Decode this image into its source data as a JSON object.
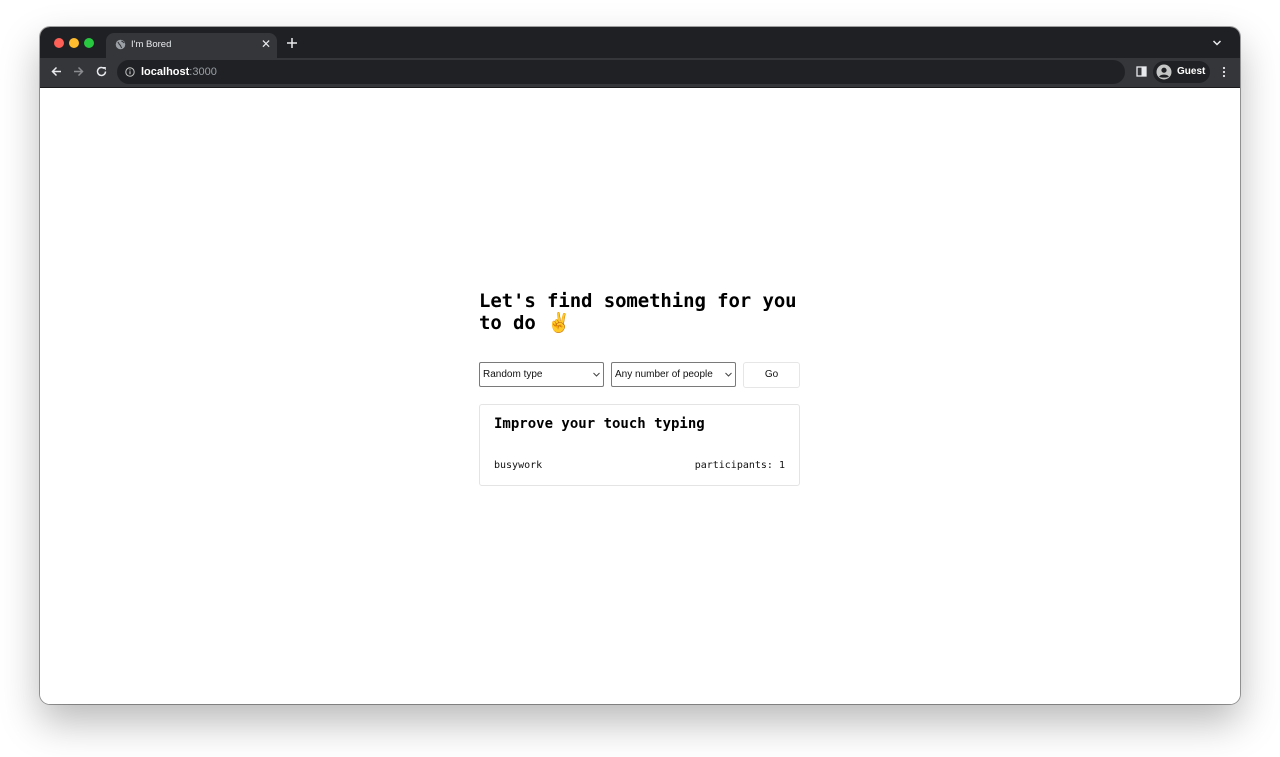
{
  "browser": {
    "tab": {
      "title": "I'm Bored",
      "close_glyph": "✕",
      "favicon": "globe-icon"
    },
    "address": {
      "host": "localhost",
      "port": ":3000"
    },
    "profile": {
      "name": "Guest"
    },
    "colors": {
      "titlebar": "#1f2023",
      "toolbar": "#35363a",
      "omnibox": "#202124"
    }
  },
  "page": {
    "headline": "Let's find something for you to do ✌️",
    "type_select": {
      "value": "Random type"
    },
    "people_select": {
      "value": "Any number of people"
    },
    "go_label": "Go",
    "activity": {
      "title": "Improve your touch typing",
      "type": "busywork",
      "participants": "participants: 1"
    }
  }
}
